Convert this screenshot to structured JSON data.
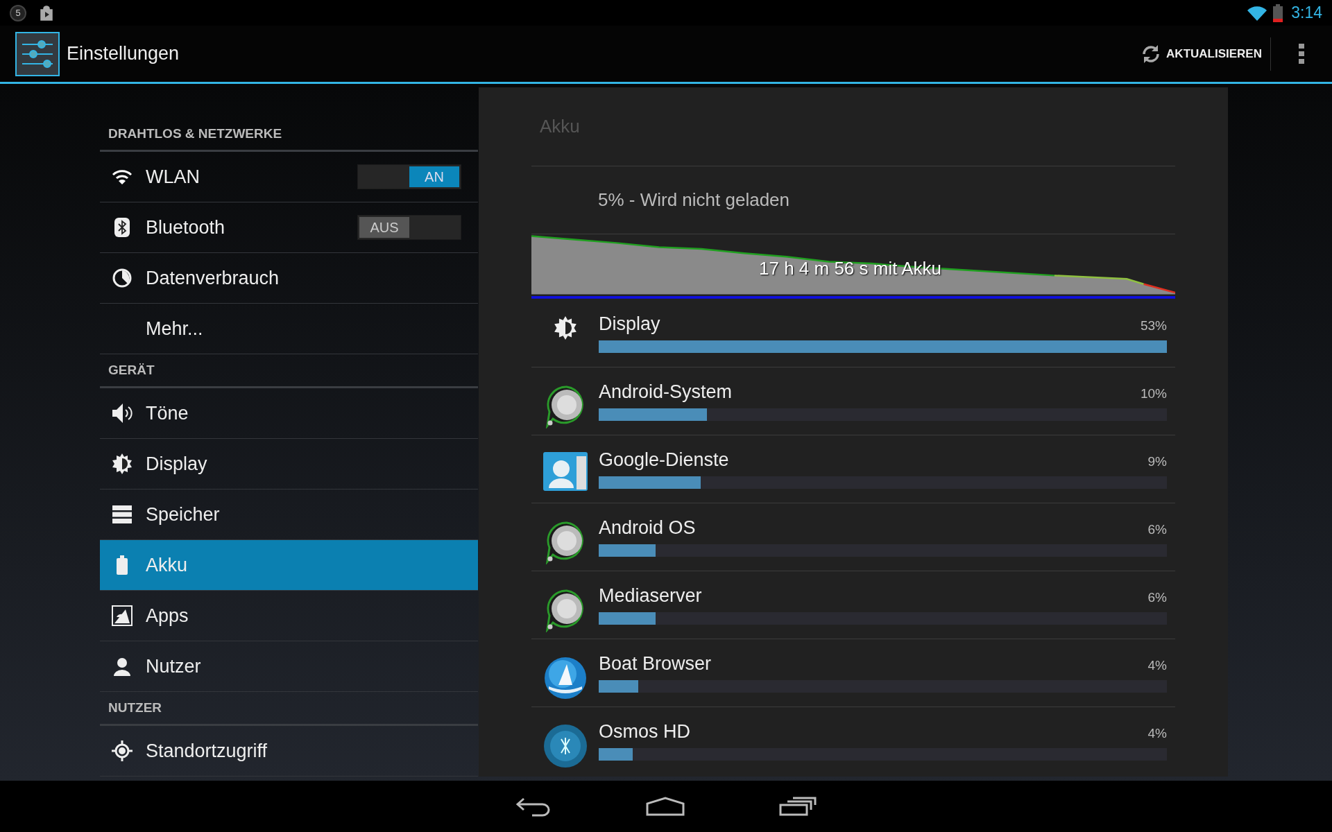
{
  "status_bar": {
    "notification_count": "5",
    "time": "3:14"
  },
  "action_bar": {
    "title": "Einstellungen",
    "refresh_button": "AKTUALISIEREN"
  },
  "sidebar": {
    "sections": [
      {
        "header": "DRAHTLOS & NETZWERKE",
        "items": [
          {
            "label": "WLAN",
            "kind": "toggle",
            "toggle": {
              "label": "AN",
              "on": true
            },
            "selected": false
          },
          {
            "label": "Bluetooth",
            "kind": "toggle",
            "toggle": {
              "label": "AUS",
              "on": false
            },
            "selected": false
          },
          {
            "label": "Datenverbrauch",
            "kind": "plain",
            "selected": false
          },
          {
            "label": "Mehr...",
            "kind": "plain",
            "selected": false
          }
        ]
      },
      {
        "header": "GERÄT",
        "items": [
          {
            "label": "Töne",
            "kind": "plain",
            "selected": false
          },
          {
            "label": "Display",
            "kind": "plain",
            "selected": false
          },
          {
            "label": "Speicher",
            "kind": "plain",
            "selected": false
          },
          {
            "label": "Akku",
            "kind": "plain",
            "selected": true
          },
          {
            "label": "Apps",
            "kind": "plain",
            "selected": false
          },
          {
            "label": "Nutzer",
            "kind": "plain",
            "selected": false
          }
        ]
      },
      {
        "header": "NUTZER",
        "items": [
          {
            "label": "Standortzugriff",
            "kind": "plain",
            "selected": false
          }
        ]
      }
    ]
  },
  "battery_panel": {
    "title": "Akku",
    "status": "5% - Wird nicht geladen",
    "graph_label": "17 h 4 m 56 s mit Akku",
    "apps": [
      {
        "name": "Display",
        "percent": "53%",
        "level": 1.0
      },
      {
        "name": "Android-System",
        "percent": "10%",
        "level": 0.19
      },
      {
        "name": "Google-Dienste",
        "percent": "9%",
        "level": 0.18
      },
      {
        "name": "Android OS",
        "percent": "6%",
        "level": 0.1
      },
      {
        "name": "Mediaserver",
        "percent": "6%",
        "level": 0.1
      },
      {
        "name": "Boat Browser",
        "percent": "4%",
        "level": 0.07
      },
      {
        "name": "Osmos HD",
        "percent": "4%",
        "level": 0.06
      }
    ]
  }
}
